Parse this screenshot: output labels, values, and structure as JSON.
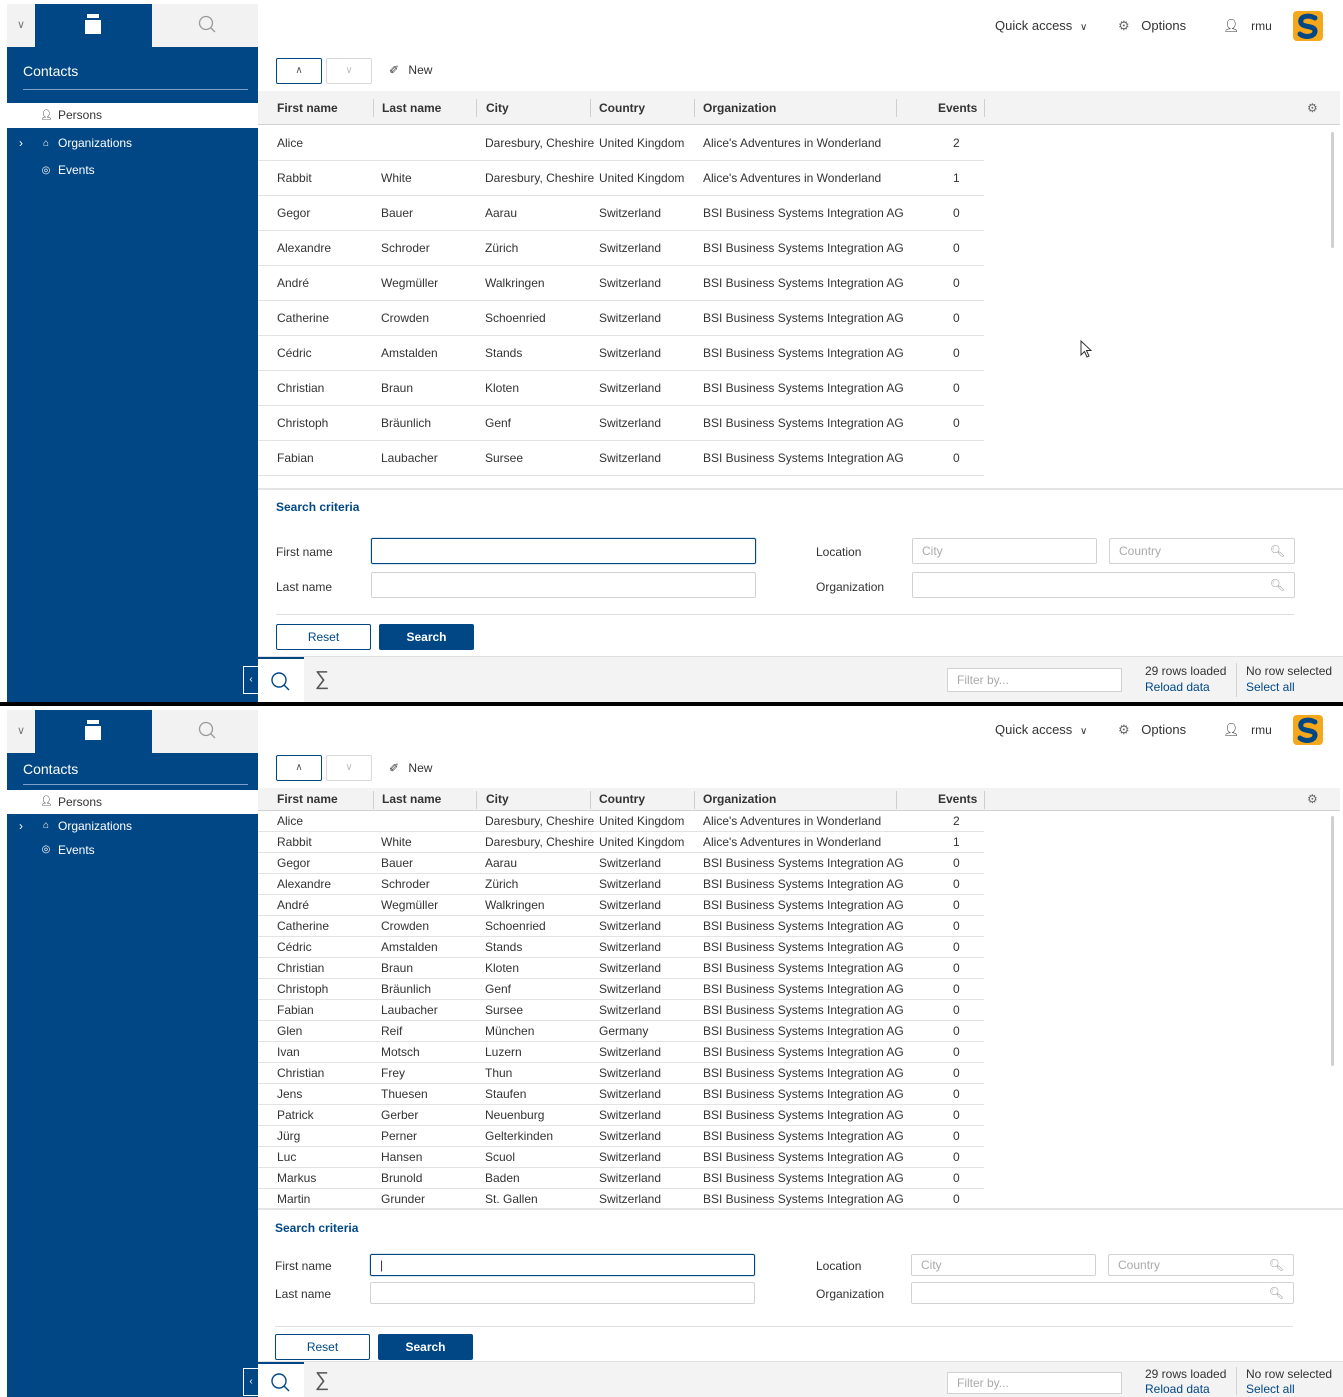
{
  "header": {
    "quick_access": "Quick access",
    "options": "Options",
    "user": "rmu"
  },
  "nav": {
    "title": "Contacts",
    "items": [
      {
        "label": "Persons",
        "icon": "person-icon",
        "selected": true
      },
      {
        "label": "Organizations",
        "icon": "home-icon",
        "expandable": true
      },
      {
        "label": "Events",
        "icon": "target-icon"
      }
    ]
  },
  "toolbar": {
    "new_label": "New"
  },
  "table": {
    "columns": [
      "First name",
      "Last name",
      "City",
      "Country",
      "Organization",
      "Events"
    ],
    "rows_frame1": [
      [
        "Alice",
        "",
        "Daresbury, Cheshire",
        "United Kingdom",
        "Alice's Adventures in Wonderland",
        "2"
      ],
      [
        "Rabbit",
        "White",
        "Daresbury, Cheshire",
        "United Kingdom",
        "Alice's Adventures in Wonderland",
        "1"
      ],
      [
        "Gegor",
        "Bauer",
        "Aarau",
        "Switzerland",
        "BSI Business Systems Integration AG",
        "0"
      ],
      [
        "Alexandre",
        "Schroder",
        "Zürich",
        "Switzerland",
        "BSI Business Systems Integration AG",
        "0"
      ],
      [
        "André",
        "Wegmüller",
        "Walkringen",
        "Switzerland",
        "BSI Business Systems Integration AG",
        "0"
      ],
      [
        "Catherine",
        "Crowden",
        "Schoenried",
        "Switzerland",
        "BSI Business Systems Integration AG",
        "0"
      ],
      [
        "Cédric",
        "Amstalden",
        "Stands",
        "Switzerland",
        "BSI Business Systems Integration AG",
        "0"
      ],
      [
        "Christian",
        "Braun",
        "Kloten",
        "Switzerland",
        "BSI Business Systems Integration AG",
        "0"
      ],
      [
        "Christoph",
        "Bräunlich",
        "Genf",
        "Switzerland",
        "BSI Business Systems Integration AG",
        "0"
      ],
      [
        "Fabian",
        "Laubacher",
        "Sursee",
        "Switzerland",
        "BSI Business Systems Integration AG",
        "0"
      ],
      [
        "Glen",
        "Reif",
        "München",
        "Germany",
        "BSI Business Systems Integration AG",
        "0"
      ]
    ],
    "rows_frame2": [
      [
        "Alice",
        "",
        "Daresbury, Cheshire",
        "United Kingdom",
        "Alice's Adventures in Wonderland",
        "2"
      ],
      [
        "Rabbit",
        "White",
        "Daresbury, Cheshire",
        "United Kingdom",
        "Alice's Adventures in Wonderland",
        "1"
      ],
      [
        "Gegor",
        "Bauer",
        "Aarau",
        "Switzerland",
        "BSI Business Systems Integration AG",
        "0"
      ],
      [
        "Alexandre",
        "Schroder",
        "Zürich",
        "Switzerland",
        "BSI Business Systems Integration AG",
        "0"
      ],
      [
        "André",
        "Wegmüller",
        "Walkringen",
        "Switzerland",
        "BSI Business Systems Integration AG",
        "0"
      ],
      [
        "Catherine",
        "Crowden",
        "Schoenried",
        "Switzerland",
        "BSI Business Systems Integration AG",
        "0"
      ],
      [
        "Cédric",
        "Amstalden",
        "Stands",
        "Switzerland",
        "BSI Business Systems Integration AG",
        "0"
      ],
      [
        "Christian",
        "Braun",
        "Kloten",
        "Switzerland",
        "BSI Business Systems Integration AG",
        "0"
      ],
      [
        "Christoph",
        "Bräunlich",
        "Genf",
        "Switzerland",
        "BSI Business Systems Integration AG",
        "0"
      ],
      [
        "Fabian",
        "Laubacher",
        "Sursee",
        "Switzerland",
        "BSI Business Systems Integration AG",
        "0"
      ],
      [
        "Glen",
        "Reif",
        "München",
        "Germany",
        "BSI Business Systems Integration AG",
        "0"
      ],
      [
        "Ivan",
        "Motsch",
        "Luzern",
        "Switzerland",
        "BSI Business Systems Integration AG",
        "0"
      ],
      [
        "Christian",
        "Frey",
        "Thun",
        "Switzerland",
        "BSI Business Systems Integration AG",
        "0"
      ],
      [
        "Jens",
        "Thuesen",
        "Staufen",
        "Switzerland",
        "BSI Business Systems Integration AG",
        "0"
      ],
      [
        "Patrick",
        "Gerber",
        "Neuenburg",
        "Switzerland",
        "BSI Business Systems Integration AG",
        "0"
      ],
      [
        "Jürg",
        "Perner",
        "Gelterkinden",
        "Switzerland",
        "BSI Business Systems Integration AG",
        "0"
      ],
      [
        "Luc",
        "Hansen",
        "Scuol",
        "Switzerland",
        "BSI Business Systems Integration AG",
        "0"
      ],
      [
        "Markus",
        "Brunold",
        "Baden",
        "Switzerland",
        "BSI Business Systems Integration AG",
        "0"
      ],
      [
        "Martin",
        "Grunder",
        "St. Gallen",
        "Switzerland",
        "BSI Business Systems Integration AG",
        "0"
      ]
    ]
  },
  "search_form": {
    "title": "Search criteria",
    "first_name_label": "First name",
    "last_name_label": "Last name",
    "location_label": "Location",
    "organization_label": "Organization",
    "city_placeholder": "City",
    "country_placeholder": "Country",
    "reset_label": "Reset",
    "search_label": "Search"
  },
  "footer": {
    "filter_placeholder": "Filter by...",
    "rows_loaded": "29 rows loaded",
    "reload": "Reload data",
    "selection": "No row selected",
    "select_all": "Select all"
  },
  "colors": {
    "primary": "#014786",
    "accent": "#f6a81c"
  }
}
